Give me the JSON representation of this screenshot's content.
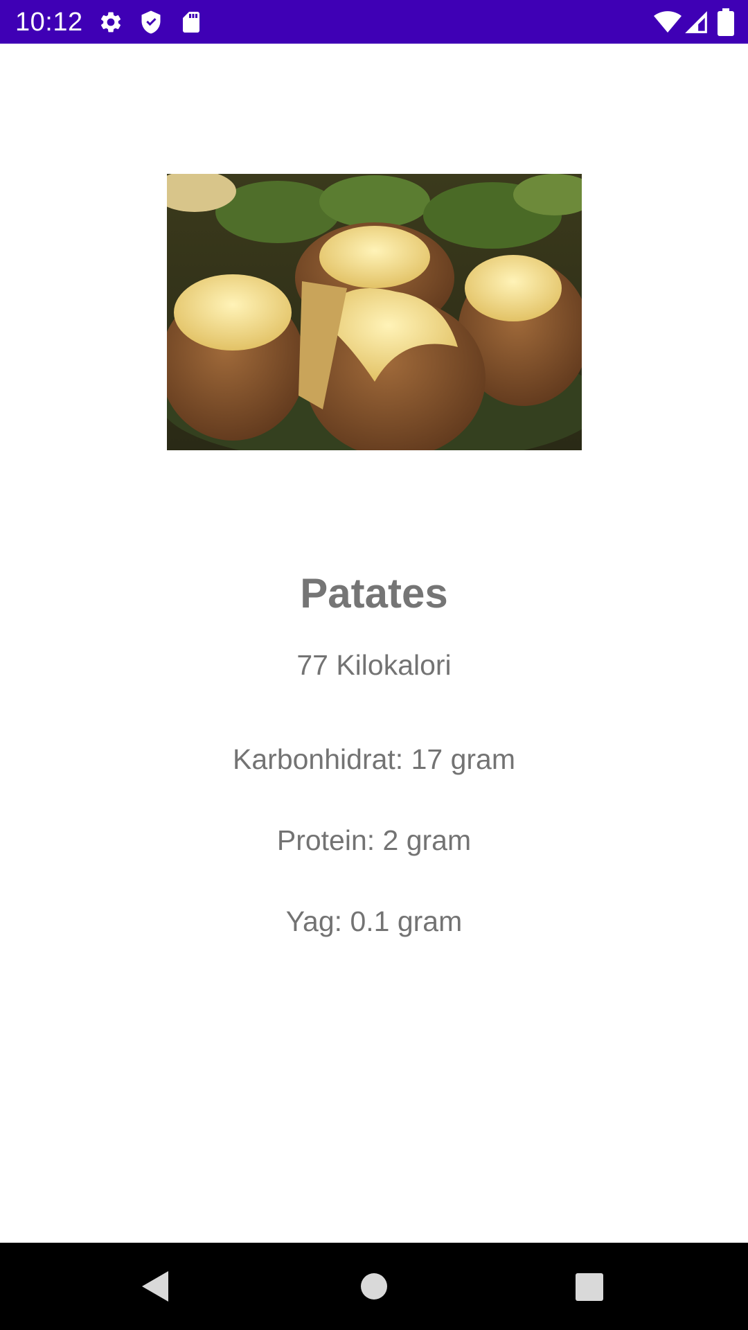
{
  "status_bar": {
    "time": "10:12",
    "background_color": "#3f00b5",
    "left_icons": [
      "gear-icon",
      "shield-icon",
      "sd-card-icon"
    ],
    "right_icons": [
      "wifi-icon",
      "signal-icon",
      "battery-icon"
    ]
  },
  "food": {
    "image_icon": "baked-potato-image",
    "title": "Patates",
    "calories": "77 Kilokalori",
    "carbohydrate": "Karbonhidrat: 17 gram",
    "protein": "Protein: 2 gram",
    "fat": "Yag: 0.1 gram"
  },
  "nav_bar": {
    "buttons": [
      "back-icon",
      "home-icon",
      "recents-icon"
    ]
  }
}
